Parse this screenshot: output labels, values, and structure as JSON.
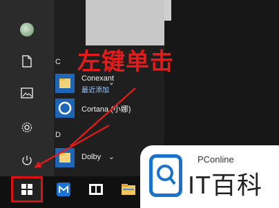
{
  "start_menu": {
    "rail": {
      "items": [
        {
          "icon": "avatar"
        },
        {
          "icon": "document-icon"
        },
        {
          "icon": "pictures-icon"
        },
        {
          "icon": "settings-gear-icon"
        },
        {
          "icon": "power-icon"
        }
      ]
    },
    "apps": {
      "sections": [
        {
          "letter": "C"
        },
        {
          "letter": "D"
        }
      ],
      "items": [
        {
          "name": "Conexant",
          "subtext": "最近添加",
          "icon": "folder-icon",
          "has_chevron": true
        },
        {
          "name": "Cortana (小娜)",
          "icon": "cortana-ring-icon"
        },
        {
          "name": "Dolby",
          "icon": "folder-icon",
          "has_chevron": true
        }
      ]
    }
  },
  "annotation": {
    "text": "左键单击",
    "color": "#e31b1b"
  },
  "taskbar": {
    "items": [
      {
        "icon": "windows-start-icon",
        "highlighted": true
      },
      {
        "icon": "maxthon-browser-icon"
      },
      {
        "icon": "dolby-app-icon"
      },
      {
        "icon": "file-explorer-icon"
      }
    ]
  },
  "watermark": {
    "brand_small": "PConline",
    "brand_large": "IT百科",
    "accent": "#1a73c9"
  }
}
